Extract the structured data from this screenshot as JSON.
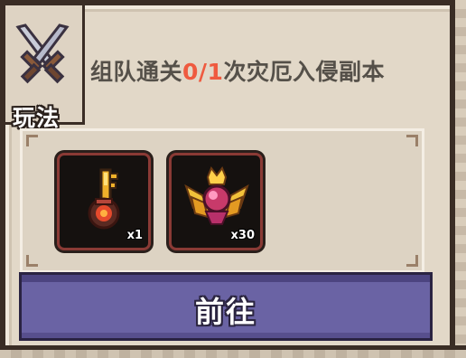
{
  "mode": {
    "label": "玩法",
    "icon": "crossed-swords-icon"
  },
  "quest": {
    "prefix": "组队通关",
    "progress": "0/1",
    "suffix": "次灾厄入侵副本",
    "progress_color": "#ef5a3f"
  },
  "rewards": [
    {
      "icon": "fire-key-icon",
      "quantity": "x1"
    },
    {
      "icon": "winged-gem-emblem-icon",
      "quantity": "x30"
    }
  ],
  "actions": {
    "go_label": "前往",
    "button_color": "#6a63a4"
  }
}
